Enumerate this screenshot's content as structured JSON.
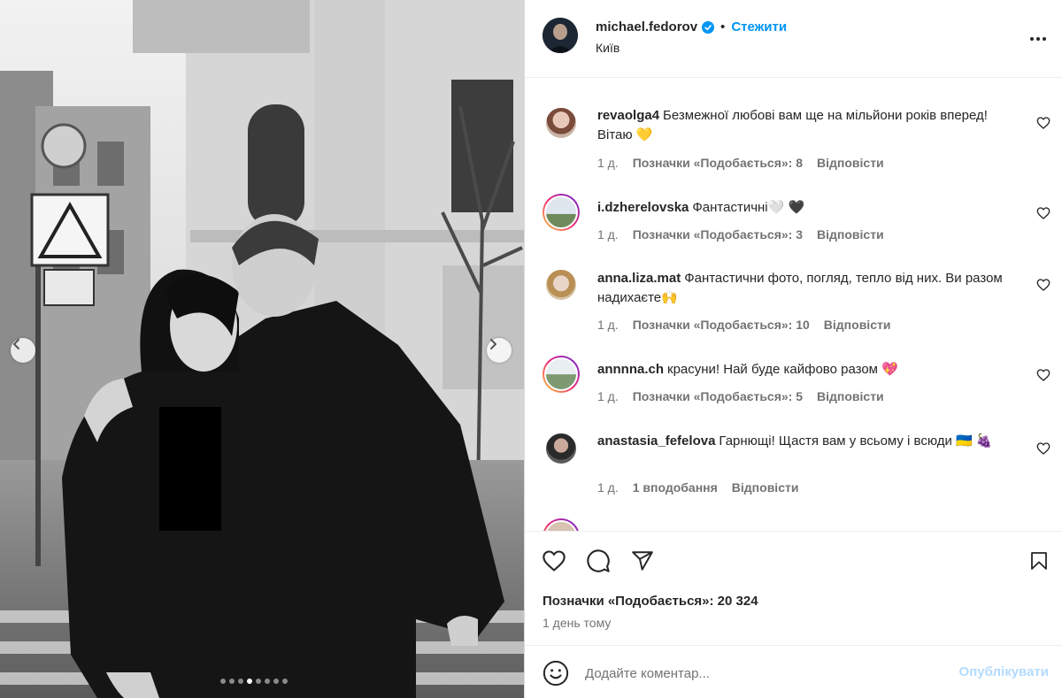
{
  "post": {
    "author": "michael.fedorov",
    "separator": "•",
    "follow_label": "Стежити",
    "location": "Київ",
    "likes": "Позначки «Подобається»: 20 324",
    "time": "1 день тому"
  },
  "carousel": {
    "count": 8,
    "active_index": 3
  },
  "comments": [
    {
      "username": "revaolga4",
      "text": "Безмежної любові вам ще на мільйони років вперед! Вітаю 💛",
      "age": "1 д.",
      "likes": "Позначки «Подобається»: 8",
      "reply": "Відповісти"
    },
    {
      "username": "i.dzherelovska",
      "text": "Фантастичні🤍 🖤",
      "age": "1 д.",
      "likes": "Позначки «Подобається»: 3",
      "reply": "Відповісти"
    },
    {
      "username": "anna.liza.mat",
      "text": "Фантастични фото, погляд, тепло від них. Ви разом надихаєте🙌",
      "age": "1 д.",
      "likes": "Позначки «Подобається»: 10",
      "reply": "Відповісти"
    },
    {
      "username": "annnna.ch",
      "text": "красуни! Най буде кайфово разом 💖",
      "age": "1 д.",
      "likes": "Позначки «Подобається»: 5",
      "reply": "Відповісти"
    },
    {
      "username": "anastasia_fefelova",
      "text": "Гарнющі! Щастя вам у всьому і всюди 🇺🇦 🍇",
      "age": "1 д.",
      "likes": "1 вподобання",
      "reply": "Відповісти"
    }
  ],
  "add_comment": {
    "placeholder": "Додайте коментар...",
    "post_label": "Опублікувати"
  },
  "colors": {
    "accent": "#0095f6",
    "post_disabled": "#b3dbff",
    "secondary_text": "#737373",
    "verified": "#0095f6"
  },
  "icons": [
    "chevron-left-icon",
    "chevron-right-icon",
    "verified-badge-icon",
    "more-options-icon",
    "heart-icon",
    "comment-icon",
    "share-icon",
    "bookmark-icon",
    "emoji-icon"
  ]
}
